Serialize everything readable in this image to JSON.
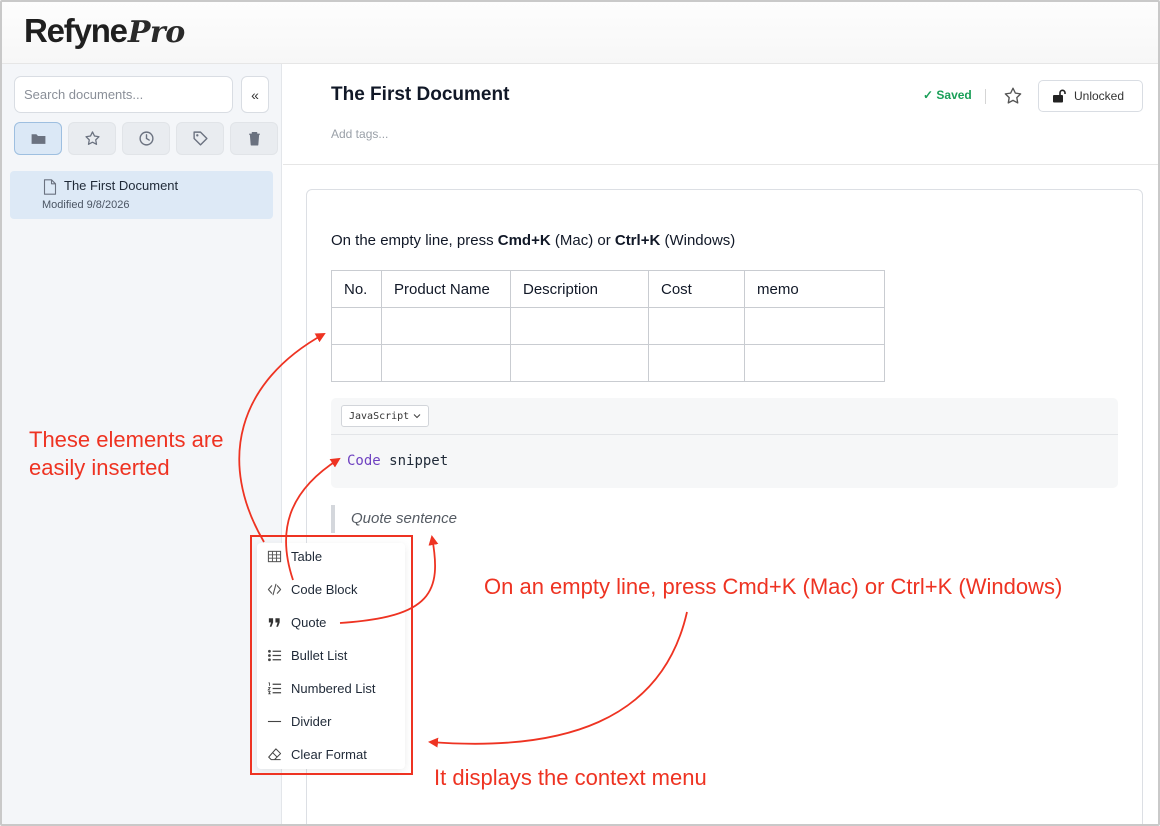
{
  "app": {
    "logo_main": "Refyne",
    "logo_pro": "Pro"
  },
  "sidebar": {
    "search_placeholder": "Search documents...",
    "collapse_label": "«",
    "filters": [
      "folder-icon",
      "star-icon",
      "clock-icon",
      "tag-icon",
      "trash-icon"
    ],
    "documents": [
      {
        "title": "The First Document",
        "modified": "Modified 9/8/2026"
      }
    ]
  },
  "document": {
    "title": "The First Document",
    "tags_placeholder": "Add tags...",
    "saved_label": "✓ Saved",
    "lock_label": "Unlocked"
  },
  "editor": {
    "line1_part1": "On the empty line, press ",
    "line1_bold1": "Cmd+K",
    "line1_part2": " (Mac) or ",
    "line1_bold2": "Ctrl+K",
    "line1_part3": " (Windows)",
    "table": {
      "headers": [
        "No.",
        "Product Name",
        "Description",
        "Cost",
        "memo"
      ],
      "rows": [
        [
          "",
          "",
          "",
          "",
          ""
        ],
        [
          "",
          "",
          "",
          "",
          ""
        ]
      ]
    },
    "code": {
      "language": "JavaScript",
      "keyword": "Code",
      "rest": "snippet"
    },
    "quote": "Quote sentence"
  },
  "context_menu": {
    "items": [
      {
        "label": "Table",
        "icon": "table-icon"
      },
      {
        "label": "Code Block",
        "icon": "code-icon"
      },
      {
        "label": "Quote",
        "icon": "quote-icon"
      },
      {
        "label": "Bullet List",
        "icon": "bullet-list-icon"
      },
      {
        "label": "Numbered List",
        "icon": "numbered-list-icon"
      },
      {
        "label": "Divider",
        "icon": "divider-icon"
      },
      {
        "label": "Clear Format",
        "icon": "eraser-icon"
      }
    ]
  },
  "annotations": {
    "inserted": "These elements are easily inserted",
    "shortcut": "On an empty line, press Cmd+K (Mac) or Ctrl+K (Windows)",
    "context": "It displays the context menu",
    "color": "#ee3322"
  }
}
